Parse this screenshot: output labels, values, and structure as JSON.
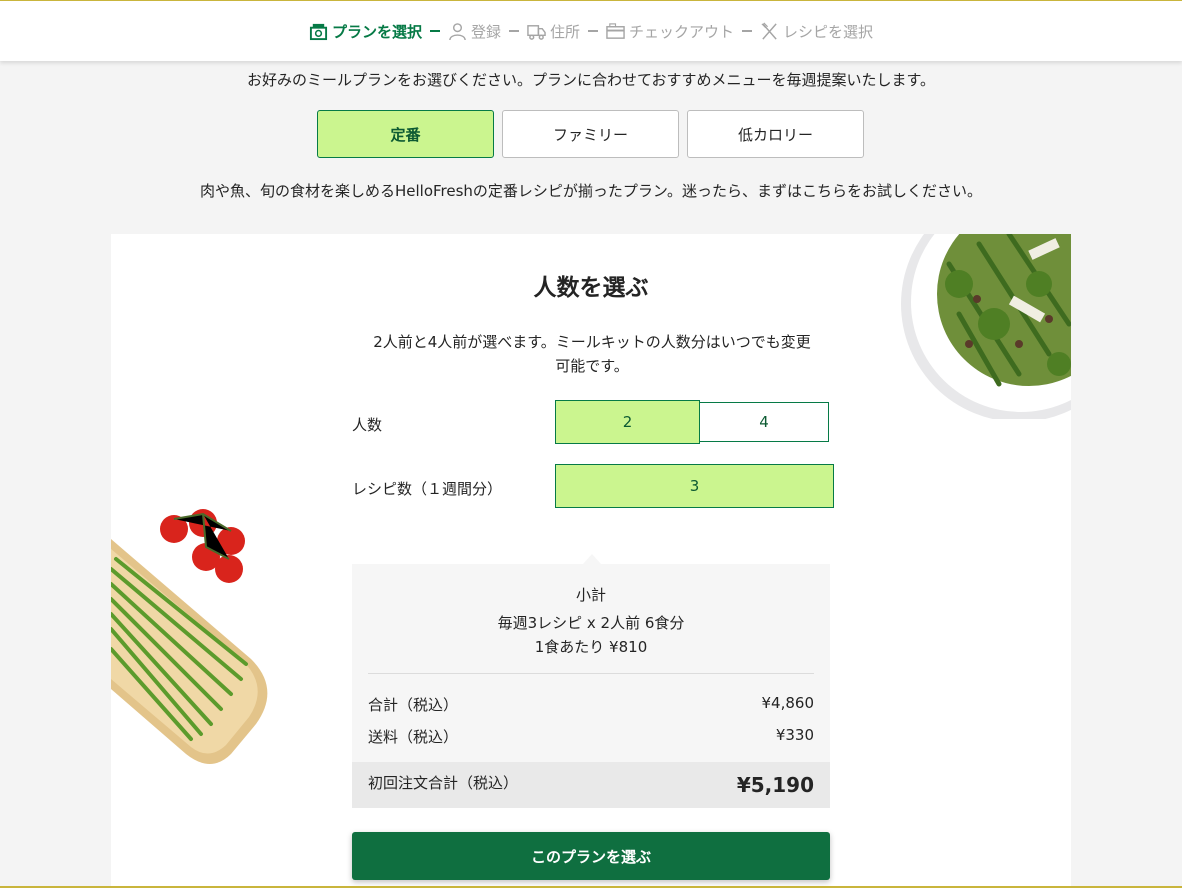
{
  "stepper": {
    "steps": [
      {
        "label": "プランを選択",
        "icon": "box-icon"
      },
      {
        "label": "登録",
        "icon": "user-icon"
      },
      {
        "label": "住所",
        "icon": "truck-icon"
      },
      {
        "label": "チェックアウト",
        "icon": "card-icon"
      },
      {
        "label": "レシピを選択",
        "icon": "utensils-icon"
      }
    ],
    "active_index": 0,
    "active_color": "#067a46"
  },
  "intro_text": "お好みのミールプランをお選びください。プランに合わせておすすめメニューを毎週提案いたします。",
  "plans": [
    {
      "label": "定番",
      "selected": true
    },
    {
      "label": "ファミリー",
      "selected": false
    },
    {
      "label": "低カロリー",
      "selected": false
    }
  ],
  "plan_description": "肉や魚、旬の食材を楽しめるHelloFreshの定番レシピが揃ったプラン。迷ったら、まずはこちらをお試しください。",
  "card": {
    "title": "人数を選ぶ",
    "note_line1": "2人前と4人前が選べます。ミールキットの人数分はいつでも変更",
    "note_line2": "可能です。",
    "servings_label": "人数",
    "servings_options": [
      "2",
      "4"
    ],
    "servings_selected": "2",
    "recipes_label": "レシピ数（１週間分）",
    "recipes_options": [
      "3"
    ],
    "recipes_selected": "3"
  },
  "summary": {
    "heading": "小計",
    "detail": "毎週3レシピ x 2人前 6食分",
    "per_meal": "1食あたり ¥810",
    "total_label": "合計（税込）",
    "total_value": "¥4,860",
    "shipping_label": "送料（税込）",
    "shipping_value": "¥330",
    "first_order_label": "初回注文合計（税込）",
    "first_order_value": "¥5,190"
  },
  "cta_label": "このプランを選ぶ",
  "colors": {
    "accent": "#067a46",
    "selected_fill": "#cbf58f",
    "cta": "#0f6f40"
  }
}
